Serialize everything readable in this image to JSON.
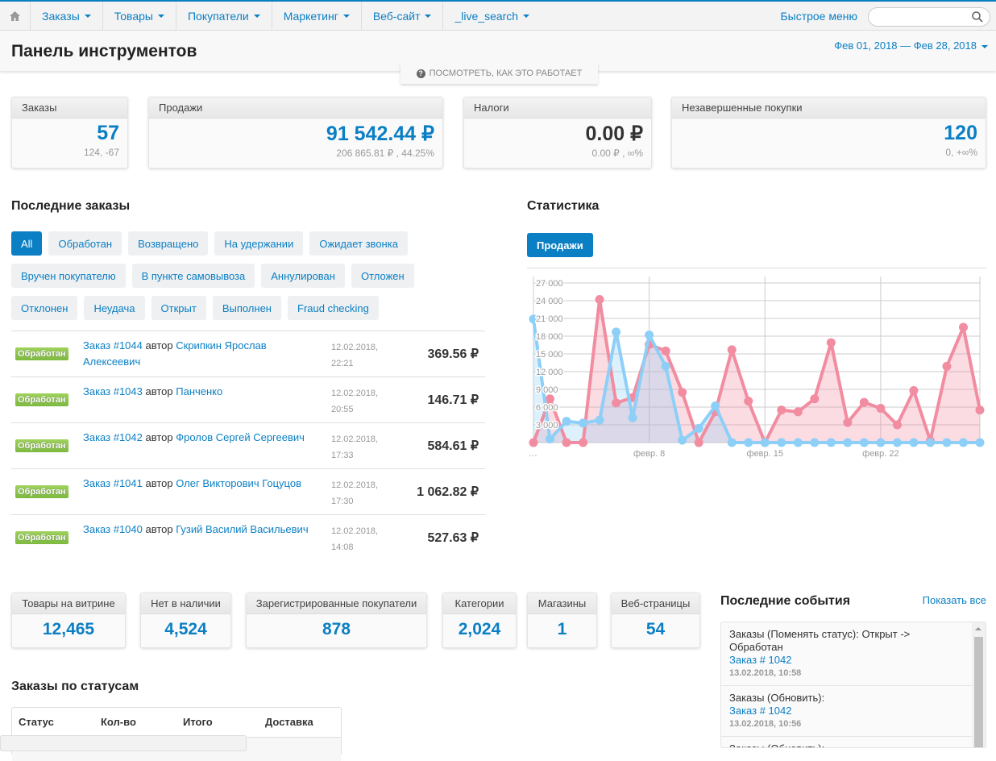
{
  "nav": {
    "items": [
      {
        "label": "Заказы"
      },
      {
        "label": "Товары"
      },
      {
        "label": "Покупатели"
      },
      {
        "label": "Маркетинг"
      },
      {
        "label": "Веб-сайт"
      },
      {
        "label": "_live_search"
      }
    ],
    "quick_menu": "Быстрое меню",
    "search_placeholder": ""
  },
  "header": {
    "title": "Панель инструментов",
    "date_range": "Фев 01, 2018 — Фев 28, 2018",
    "help": "ПОСМОТРЕТЬ, КАК ЭТО РАБОТАЕТ"
  },
  "kpis": [
    {
      "title": "Заказы",
      "value": "57",
      "sub": "124, -67"
    },
    {
      "title": "Продажи",
      "value": "91 542.44 ₽",
      "sub": "206 865.81 ₽ , 44.25%"
    },
    {
      "title": "Налоги",
      "value": "0.00 ₽",
      "sub": "0.00 ₽ , ∞%"
    },
    {
      "title": "Незавершенные покупки",
      "value": "120",
      "sub": "0, +∞%"
    }
  ],
  "recent_orders": {
    "title": "Последние заказы",
    "filters": [
      "All",
      "Обработан",
      "Возвращено",
      "На удержании",
      "Ожидает звонка",
      "Вручен покупателю",
      "В пункте самовывоза",
      "Аннулирован",
      "Отложен",
      "Отклонен",
      "Неудача",
      "Открыт",
      "Выполнен",
      "Fraud checking"
    ],
    "rows": [
      {
        "status": "Обработан",
        "order": "Заказ #1044",
        "by": "автор",
        "customer": "Скрипкин Ярослав Алексеевич",
        "date": "12.02.2018,",
        "time": "22:21",
        "total": "369.56 ₽"
      },
      {
        "status": "Обработан",
        "order": "Заказ #1043",
        "by": "автор",
        "customer": "Панченко",
        "date": "12.02.2018,",
        "time": "20:55",
        "total": "146.71 ₽"
      },
      {
        "status": "Обработан",
        "order": "Заказ #1042",
        "by": "автор",
        "customer": "Фролов Сергей Сергеевич",
        "date": "12.02.2018,",
        "time": "17:33",
        "total": "584.61 ₽"
      },
      {
        "status": "Обработан",
        "order": "Заказ #1041",
        "by": "автор",
        "customer": "Олег Викторович Гоцуцов",
        "date": "12.02.2018,",
        "time": "17:30",
        "total": "1 062.82 ₽"
      },
      {
        "status": "Обработан",
        "order": "Заказ #1040",
        "by": "автор",
        "customer": "Гузий Василий Васильевич",
        "date": "12.02.2018,",
        "time": "14:08",
        "total": "527.63 ₽"
      }
    ]
  },
  "stats": {
    "title": "Статистика",
    "tab": "Продажи"
  },
  "chart_data": {
    "type": "area",
    "x": [
      "1",
      "2",
      "3",
      "4",
      "5",
      "6",
      "7",
      "8",
      "9",
      "10",
      "11",
      "12",
      "13",
      "14",
      "15",
      "16",
      "17",
      "18",
      "19",
      "20",
      "21",
      "22",
      "23",
      "24",
      "25",
      "26",
      "27",
      "28"
    ],
    "x_ticks": [
      "…",
      "февр. 8",
      "февр. 15",
      "февр. 22"
    ],
    "y_ticks": [
      "3 000",
      "6 000",
      "9 000",
      "12 000",
      "15 000",
      "18 000",
      "21 000",
      "24 000",
      "27 000"
    ],
    "ylim": [
      0,
      27000
    ],
    "grid": true,
    "series": [
      {
        "color": "#f28ca0",
        "values": [
          0,
          7400,
          0,
          0,
          24200,
          6700,
          7600,
          16600,
          15500,
          8500,
          0,
          5200,
          15700,
          7000,
          0,
          5500,
          5200,
          7400,
          16900,
          3400,
          6800,
          5800,
          3000,
          8800,
          300,
          12900,
          19500,
          5500
        ]
      },
      {
        "color": "#8ecff8",
        "values": [
          20900,
          600,
          3600,
          3300,
          3800,
          18700,
          4200,
          18200,
          12900,
          400,
          2400,
          6200,
          0,
          0,
          0,
          0,
          0,
          0,
          0,
          0,
          0,
          0,
          0,
          0,
          0,
          0,
          0,
          0
        ]
      }
    ]
  },
  "counters": [
    {
      "title": "Товары на витрине",
      "value": "12,465"
    },
    {
      "title": "Нет в наличии",
      "value": "4,524"
    },
    {
      "title": "Зарегистрированные покупатели",
      "value": "878"
    },
    {
      "title": "Категории",
      "value": "2,024"
    },
    {
      "title": "Магазины",
      "value": "1"
    },
    {
      "title": "Веб-страницы",
      "value": "54"
    }
  ],
  "events": {
    "title": "Последние события",
    "show_all": "Показать все",
    "items": [
      {
        "text": "Заказы (Поменять статус): Открыт -> Обработан",
        "link": "Заказ # 1042",
        "time": "13.02.2018, 10:58"
      },
      {
        "text": "Заказы (Обновить):",
        "link": "Заказ # 1042",
        "time": "13.02.2018, 10:56"
      },
      {
        "text": "Заказы (Обновить):",
        "link": "",
        "time": ""
      }
    ]
  },
  "status_table": {
    "title": "Заказы по статусам",
    "headers": [
      "Статус",
      "Кол-во",
      "Итого",
      "Доставка"
    ]
  }
}
